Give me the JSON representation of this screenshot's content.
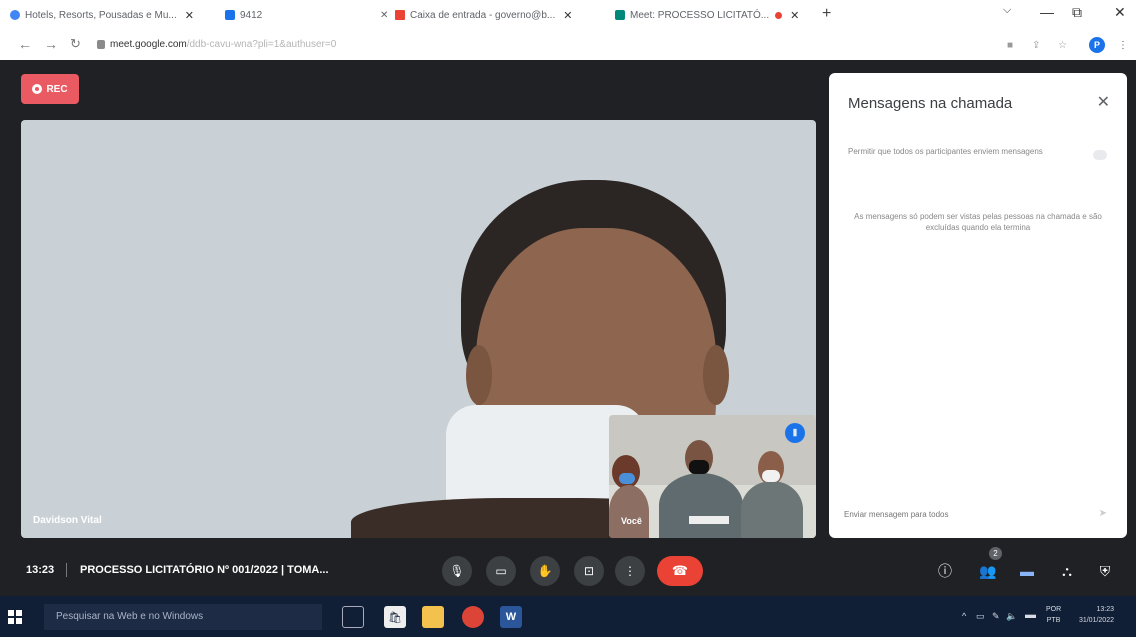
{
  "browser": {
    "tabs": [
      {
        "title": "Hotels, Resorts, Pousadas e Mu...",
        "color": "#4285f4"
      },
      {
        "title": "9412",
        "color": "#1a73e8"
      },
      {
        "title": "Caixa de entrada - governo@b...",
        "color": "#ea4335"
      },
      {
        "title": "Meet: PROCESSO LICITATÓ...",
        "color": "#00897b"
      }
    ],
    "new_tab": "+",
    "close_glyph": "✕",
    "window_controls": {
      "minimize": "—",
      "maximize": "⧉",
      "close": "✕",
      "tab_search": "⌵"
    },
    "url_domain": "meet.google.com",
    "url_path": "/ddb-cavu-wna?pli=1&authuser=0",
    "profile_initial": "P"
  },
  "meet": {
    "rec_label": "REC",
    "main_participant": "Davidson Vital",
    "self_label": "Você",
    "time": "13:23",
    "meeting_title": "PROCESSO LICITATÓRIO Nº 001/2022 | TOMA...",
    "participant_count": "2",
    "chat": {
      "title": "Mensagens na chamada",
      "allow_text": "Permitir que todos os participantes enviem mensagens",
      "note": "As mensagens só podem ser vistas pelas pessoas na chamada e são excluídas quando ela termina",
      "input_placeholder": "Enviar mensagem para todos"
    },
    "controls": [
      "mic-icon",
      "camera-icon",
      "raise-hand-icon",
      "present-icon",
      "more-options-icon",
      "end-call-icon"
    ],
    "right_controls": [
      "info-icon",
      "people-icon",
      "chat-icon",
      "activities-icon",
      "host-controls-icon"
    ]
  },
  "taskbar": {
    "search_placeholder": "Pesquisar na Web e no Windows",
    "language_line1": "POR",
    "language_line2": "PTB",
    "clock_time": "13:23",
    "clock_date": "31/01/2022"
  },
  "colors": {
    "meet_bg": "#202124",
    "rec": "#ea5a63",
    "end_call": "#ea4335",
    "accent": "#1a73e8",
    "taskbar": "#101e36"
  }
}
